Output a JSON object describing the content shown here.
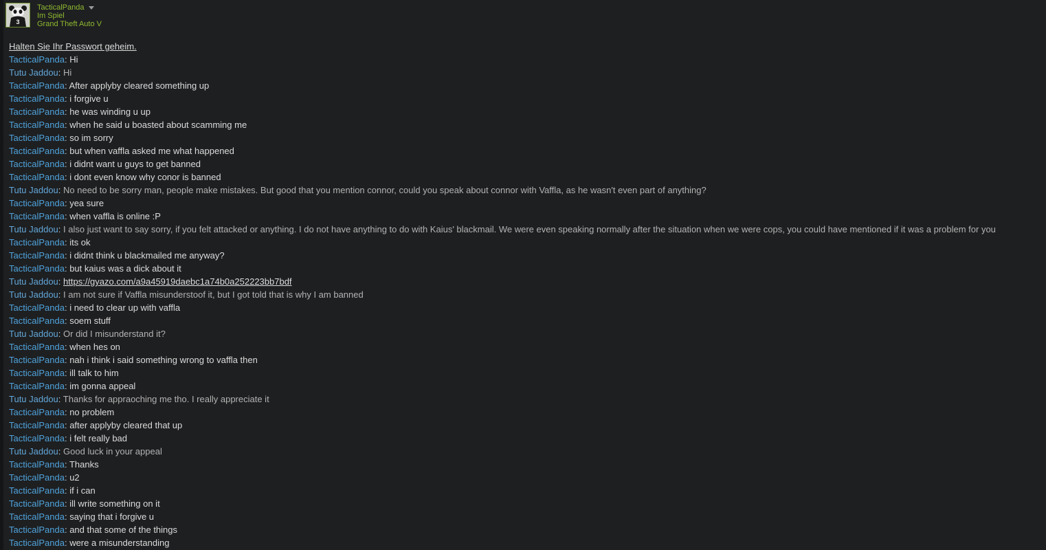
{
  "header": {
    "username": "TacticalPanda",
    "status": "Im Spiel",
    "game": "Grand Theft Auto V",
    "avatar_icon": "panda-avatar-icon",
    "dropdown_icon": "caret-down-icon"
  },
  "colors": {
    "self_name": "#4fa3db",
    "other_name": "#62a7d8",
    "status_green": "#8fba30",
    "background": "#1e1f21"
  },
  "notice": "Halten Sie Ihr Passwort geheim.",
  "messages": [
    {
      "sender": "TacticalPanda",
      "text": "Hi",
      "self": true
    },
    {
      "sender": "Tutu Jaddou",
      "text": "Hi",
      "self": false
    },
    {
      "sender": "TacticalPanda",
      "text": "After applyby cleared something up",
      "self": true
    },
    {
      "sender": "TacticalPanda",
      "text": "i forgive u",
      "self": true
    },
    {
      "sender": "TacticalPanda",
      "text": "he was winding u up",
      "self": true
    },
    {
      "sender": "TacticalPanda",
      "text": "when he said u boasted about scamming me",
      "self": true
    },
    {
      "sender": "TacticalPanda",
      "text": "so im sorry",
      "self": true
    },
    {
      "sender": "TacticalPanda",
      "text": "but when vaffla asked me what happened",
      "self": true
    },
    {
      "sender": "TacticalPanda",
      "text": "i didnt want u guys to get banned",
      "self": true
    },
    {
      "sender": "TacticalPanda",
      "text": "i dont even know why conor is banned",
      "self": true
    },
    {
      "sender": "Tutu Jaddou",
      "text": "No need to be sorry man, people make mistakes. But good that you mention connor, could you speak about connor with Vaffla, as he wasn't even part of anything?",
      "self": false
    },
    {
      "sender": "TacticalPanda",
      "text": "yea sure",
      "self": true
    },
    {
      "sender": "TacticalPanda",
      "text": "when vaffla is online :P",
      "self": true
    },
    {
      "sender": "Tutu Jaddou",
      "text": "I also just want to say sorry, if you felt attacked or anything. I do not have anything to do with Kaius' blackmail. We were even speaking normally after the situation when we were cops, you could have mentioned if it was a problem for you",
      "self": false
    },
    {
      "sender": "TacticalPanda",
      "text": "its ok",
      "self": true
    },
    {
      "sender": "TacticalPanda",
      "text": "i didnt think u blackmailed me anyway?",
      "self": true
    },
    {
      "sender": "TacticalPanda",
      "text": "but kaius was a dick about it",
      "self": true
    },
    {
      "sender": "Tutu Jaddou",
      "text": "https://gyazo.com/a9a45919daebc1a74b0a252223bb7bdf",
      "self": false,
      "link": true
    },
    {
      "sender": "Tutu Jaddou",
      "text": "I am not sure if Vaffla misunderstoof it, but I got told that is why I am banned",
      "self": false
    },
    {
      "sender": "TacticalPanda",
      "text": "i need to clear up with vaffla",
      "self": true
    },
    {
      "sender": "TacticalPanda",
      "text": "soem stuff",
      "self": true
    },
    {
      "sender": "Tutu Jaddou",
      "text": "Or did I misunderstand it?",
      "self": false
    },
    {
      "sender": "TacticalPanda",
      "text": "when hes on",
      "self": true
    },
    {
      "sender": "TacticalPanda",
      "text": "nah i think i said something wrong to vaffla then",
      "self": true
    },
    {
      "sender": "TacticalPanda",
      "text": "ill talk to him",
      "self": true
    },
    {
      "sender": "TacticalPanda",
      "text": "im gonna appeal",
      "self": true
    },
    {
      "sender": "Tutu Jaddou",
      "text": "Thanks for appraoching me tho. I really appreciate it",
      "self": false
    },
    {
      "sender": "TacticalPanda",
      "text": "no problem",
      "self": true
    },
    {
      "sender": "TacticalPanda",
      "text": "after applyby cleared that up",
      "self": true
    },
    {
      "sender": "TacticalPanda",
      "text": "i felt really bad",
      "self": true
    },
    {
      "sender": "Tutu Jaddou",
      "text": "Good luck in your appeal",
      "self": false
    },
    {
      "sender": "TacticalPanda",
      "text": "Thanks",
      "self": true
    },
    {
      "sender": "TacticalPanda",
      "text": "u2",
      "self": true
    },
    {
      "sender": "TacticalPanda",
      "text": "if i can",
      "self": true
    },
    {
      "sender": "TacticalPanda",
      "text": "ill write something on it",
      "self": true
    },
    {
      "sender": "TacticalPanda",
      "text": "saying that i forgive u",
      "self": true
    },
    {
      "sender": "TacticalPanda",
      "text": "and that some of the things",
      "self": true
    },
    {
      "sender": "TacticalPanda",
      "text": "were a misunderstanding",
      "self": true
    }
  ]
}
